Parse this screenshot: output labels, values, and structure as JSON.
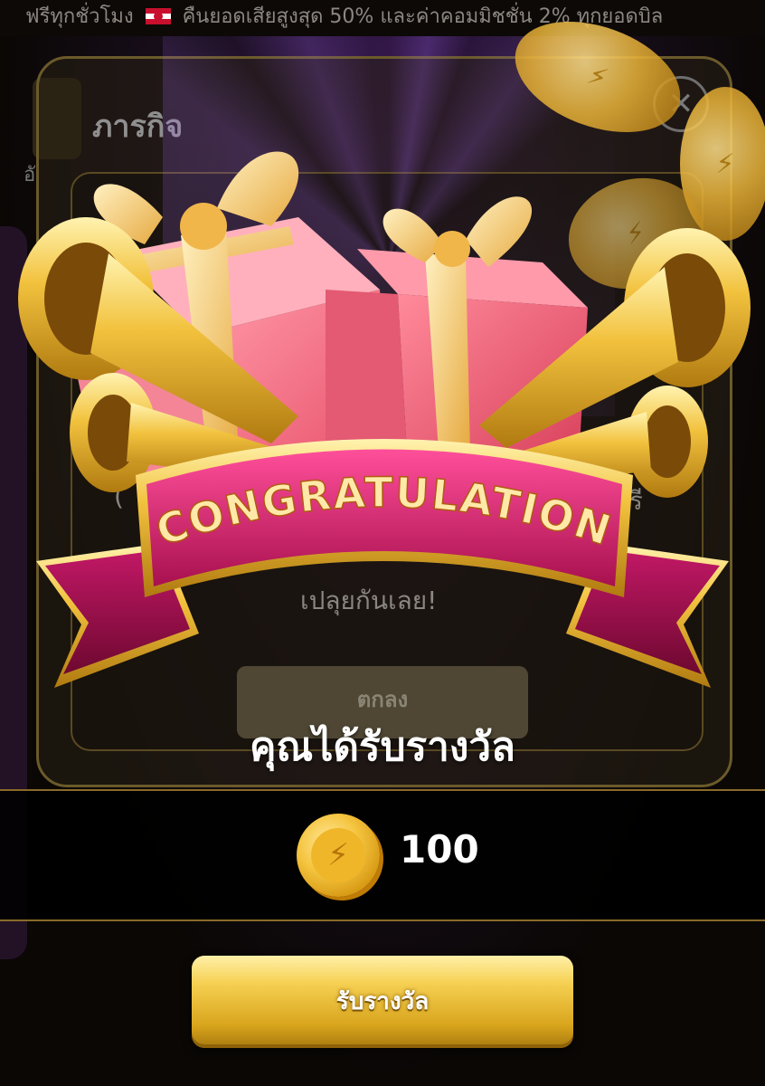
{
  "ticker": {
    "text_before": "ฟรีทุกชั่วโมง",
    "text_after": "คืนยอดเสียสูงสุด 50% และค่าคอมมิชชั่น 2% ทุกยอดบิล"
  },
  "background": {
    "title": "ภารกิจ",
    "left_label": "อั",
    "line1_left": "( ",
    "line1_right": "ฟรี",
    "line2": "เปลุยกันเลย!",
    "ok_label": "ตกลง",
    "close_glyph": "✕"
  },
  "banner": {
    "text": "CONGRATULATION"
  },
  "reward": {
    "title": "คุณได้รับรางวัล",
    "amount": "100",
    "coin_icon": "lightning-coin-icon"
  },
  "actions": {
    "claim_label": "รับรางวัล"
  },
  "colors": {
    "gold": "#f2c23e",
    "ribbon": "#c2185b",
    "gift": "#f27a8a"
  }
}
